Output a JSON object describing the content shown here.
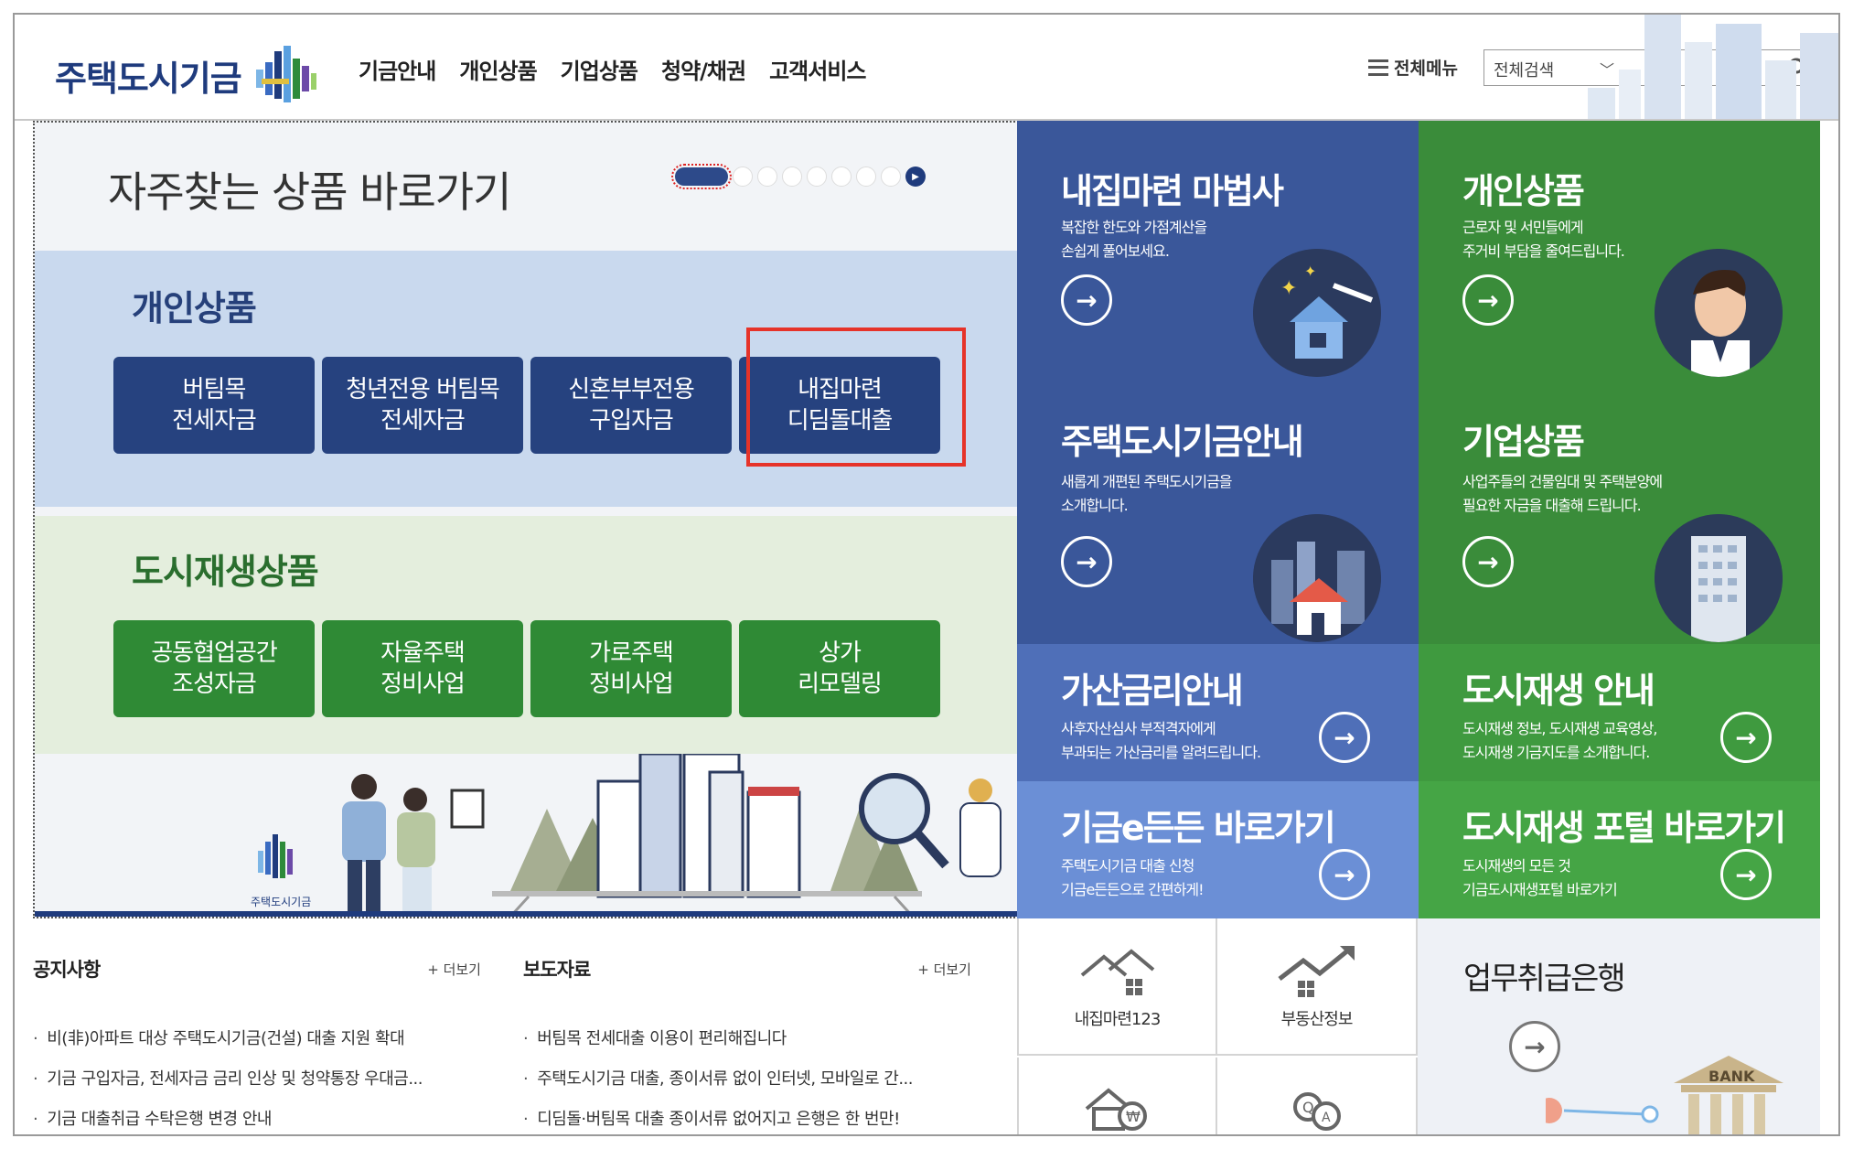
{
  "header": {
    "logo_text": "주택도시기금",
    "gnb": [
      "기금안내",
      "개인상품",
      "기업상품",
      "청약/채권",
      "고객서비스"
    ],
    "all_menu": "전체메뉴",
    "search_select": "전체검색",
    "search_placeholder": ""
  },
  "left": {
    "title": "자주찾는 상품 바로가기",
    "personal_title": "개인상품",
    "personal_buttons": [
      "버팀목\n전세자금",
      "청년전용 버팀목\n전세자금",
      "신혼부부전용\n구입자금",
      "내집마련\n디딤돌대출"
    ],
    "urban_title": "도시재생상품",
    "urban_buttons": [
      "공동협업공간\n조성자금",
      "자율주택\n정비사업",
      "가로주택\n정비사업",
      "상가\n리모델링"
    ],
    "illust_logo": "주택도시기금"
  },
  "tiles": [
    {
      "title": "내집마련 마법사",
      "desc": "복잡한 한도와 가점계산을\n손쉽게 풀어보세요.",
      "color": "#3a579a"
    },
    {
      "title": "개인상품",
      "desc": "근로자 및 서민들에게\n주거비 부담을 줄여드립니다.",
      "color": "#3a8c3a"
    },
    {
      "title": "주택도시기금안내",
      "desc": "새롭게 개편된 주택도시기금을\n소개합니다.",
      "color": "#3a579a"
    },
    {
      "title": "기업상품",
      "desc": "사업주들의 건물임대 및 주택분양에\n필요한 자금을 대출해 드립니다.",
      "color": "#3a8c3a"
    },
    {
      "title": "가산금리안내",
      "desc": "사후자산심사 부적격자에게\n부과되는 가산금리를 알려드립니다.",
      "color": "#4f6fb8"
    },
    {
      "title": "도시재생 안내",
      "desc": "도시재생 정보, 도시재생 교육영상,\n도시재생 기금지도를 소개합니다.",
      "color": "#3f9a3f"
    },
    {
      "title": "기금e든든 바로가기",
      "desc": "주택도시기금 대출 신청\n기금e든든으로 간편하게!",
      "color": "#6b8fd6"
    },
    {
      "title": "도시재생 포털 바로가기",
      "desc": "도시재생의 모든 것\n기금도시재생포털 바로가기",
      "color": "#45a545"
    }
  ],
  "notice": {
    "title": "공지사항",
    "more": "+ 더보기",
    "items": [
      "비(非)아파트 대상 주택도시기금(건설) 대출 지원 확대",
      "기금 구입자금, 전세자금 금리 인상 및 청약통장 우대금...",
      "기금 대출취급 수탁은행 변경 안내"
    ]
  },
  "press": {
    "title": "보도자료",
    "more": "+ 더보기",
    "items": [
      "버팀목 전세대출 이용이 편리해집니다",
      "주택도시기금 대출, 종이서류 없이 인터넷, 모바일로 간...",
      "디딤돌·버팀목 대출 종이서류 없어지고 은행은 한 번만!"
    ]
  },
  "quick": [
    "내집마련123",
    "부동산정보"
  ],
  "bank": {
    "title": "업무취급은행",
    "label": "BANK"
  }
}
